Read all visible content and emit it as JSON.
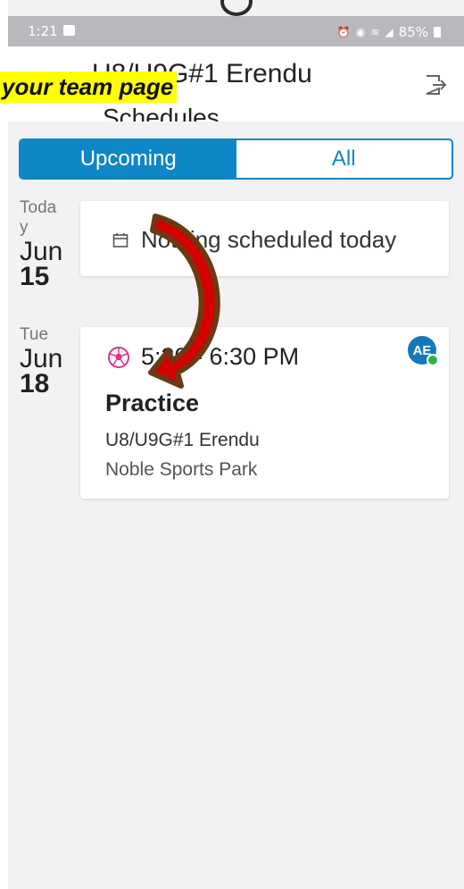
{
  "status_bar": {
    "time": "1:21",
    "battery": "85%"
  },
  "header": {
    "title": "U8/U9G#1 Erendu",
    "subtitle": "Schedules"
  },
  "callout": {
    "text": "your team page"
  },
  "tabs": {
    "upcoming": "Upcoming",
    "all": "All"
  },
  "days": [
    {
      "day": "Toda\ny",
      "month": "Jun",
      "date": "15",
      "empty_text": "Nothing scheduled today"
    },
    {
      "day": "Tue",
      "month": "Jun",
      "date": "18"
    }
  ],
  "event": {
    "time": "5:30 - 6:30 PM",
    "title": "Practice",
    "team": "U8/U9G#1 Erendu",
    "location": "Noble Sports Park",
    "avatar_initials": "AE"
  },
  "colors": {
    "accent": "#0f86c6",
    "callout": "#ffff00",
    "arrow_fill": "#d40000",
    "arrow_stroke": "#6b3a12",
    "ball": "#e0308a"
  },
  "icons": [
    "photo-icon",
    "exit-icon",
    "calendar-icon",
    "soccer-ball-icon",
    "check-icon",
    "curved-arrow-icon"
  ]
}
